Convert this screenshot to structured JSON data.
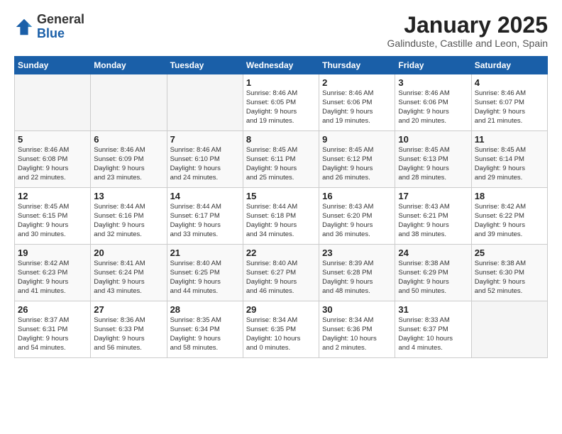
{
  "logo": {
    "general": "General",
    "blue": "Blue"
  },
  "title": "January 2025",
  "subtitle": "Galinduste, Castille and Leon, Spain",
  "weekdays": [
    "Sunday",
    "Monday",
    "Tuesday",
    "Wednesday",
    "Thursday",
    "Friday",
    "Saturday"
  ],
  "weeks": [
    [
      {
        "day": "",
        "info": ""
      },
      {
        "day": "",
        "info": ""
      },
      {
        "day": "",
        "info": ""
      },
      {
        "day": "1",
        "info": "Sunrise: 8:46 AM\nSunset: 6:05 PM\nDaylight: 9 hours\nand 19 minutes."
      },
      {
        "day": "2",
        "info": "Sunrise: 8:46 AM\nSunset: 6:06 PM\nDaylight: 9 hours\nand 19 minutes."
      },
      {
        "day": "3",
        "info": "Sunrise: 8:46 AM\nSunset: 6:06 PM\nDaylight: 9 hours\nand 20 minutes."
      },
      {
        "day": "4",
        "info": "Sunrise: 8:46 AM\nSunset: 6:07 PM\nDaylight: 9 hours\nand 21 minutes."
      }
    ],
    [
      {
        "day": "5",
        "info": "Sunrise: 8:46 AM\nSunset: 6:08 PM\nDaylight: 9 hours\nand 22 minutes."
      },
      {
        "day": "6",
        "info": "Sunrise: 8:46 AM\nSunset: 6:09 PM\nDaylight: 9 hours\nand 23 minutes."
      },
      {
        "day": "7",
        "info": "Sunrise: 8:46 AM\nSunset: 6:10 PM\nDaylight: 9 hours\nand 24 minutes."
      },
      {
        "day": "8",
        "info": "Sunrise: 8:45 AM\nSunset: 6:11 PM\nDaylight: 9 hours\nand 25 minutes."
      },
      {
        "day": "9",
        "info": "Sunrise: 8:45 AM\nSunset: 6:12 PM\nDaylight: 9 hours\nand 26 minutes."
      },
      {
        "day": "10",
        "info": "Sunrise: 8:45 AM\nSunset: 6:13 PM\nDaylight: 9 hours\nand 28 minutes."
      },
      {
        "day": "11",
        "info": "Sunrise: 8:45 AM\nSunset: 6:14 PM\nDaylight: 9 hours\nand 29 minutes."
      }
    ],
    [
      {
        "day": "12",
        "info": "Sunrise: 8:45 AM\nSunset: 6:15 PM\nDaylight: 9 hours\nand 30 minutes."
      },
      {
        "day": "13",
        "info": "Sunrise: 8:44 AM\nSunset: 6:16 PM\nDaylight: 9 hours\nand 32 minutes."
      },
      {
        "day": "14",
        "info": "Sunrise: 8:44 AM\nSunset: 6:17 PM\nDaylight: 9 hours\nand 33 minutes."
      },
      {
        "day": "15",
        "info": "Sunrise: 8:44 AM\nSunset: 6:18 PM\nDaylight: 9 hours\nand 34 minutes."
      },
      {
        "day": "16",
        "info": "Sunrise: 8:43 AM\nSunset: 6:20 PM\nDaylight: 9 hours\nand 36 minutes."
      },
      {
        "day": "17",
        "info": "Sunrise: 8:43 AM\nSunset: 6:21 PM\nDaylight: 9 hours\nand 38 minutes."
      },
      {
        "day": "18",
        "info": "Sunrise: 8:42 AM\nSunset: 6:22 PM\nDaylight: 9 hours\nand 39 minutes."
      }
    ],
    [
      {
        "day": "19",
        "info": "Sunrise: 8:42 AM\nSunset: 6:23 PM\nDaylight: 9 hours\nand 41 minutes."
      },
      {
        "day": "20",
        "info": "Sunrise: 8:41 AM\nSunset: 6:24 PM\nDaylight: 9 hours\nand 43 minutes."
      },
      {
        "day": "21",
        "info": "Sunrise: 8:40 AM\nSunset: 6:25 PM\nDaylight: 9 hours\nand 44 minutes."
      },
      {
        "day": "22",
        "info": "Sunrise: 8:40 AM\nSunset: 6:27 PM\nDaylight: 9 hours\nand 46 minutes."
      },
      {
        "day": "23",
        "info": "Sunrise: 8:39 AM\nSunset: 6:28 PM\nDaylight: 9 hours\nand 48 minutes."
      },
      {
        "day": "24",
        "info": "Sunrise: 8:38 AM\nSunset: 6:29 PM\nDaylight: 9 hours\nand 50 minutes."
      },
      {
        "day": "25",
        "info": "Sunrise: 8:38 AM\nSunset: 6:30 PM\nDaylight: 9 hours\nand 52 minutes."
      }
    ],
    [
      {
        "day": "26",
        "info": "Sunrise: 8:37 AM\nSunset: 6:31 PM\nDaylight: 9 hours\nand 54 minutes."
      },
      {
        "day": "27",
        "info": "Sunrise: 8:36 AM\nSunset: 6:33 PM\nDaylight: 9 hours\nand 56 minutes."
      },
      {
        "day": "28",
        "info": "Sunrise: 8:35 AM\nSunset: 6:34 PM\nDaylight: 9 hours\nand 58 minutes."
      },
      {
        "day": "29",
        "info": "Sunrise: 8:34 AM\nSunset: 6:35 PM\nDaylight: 10 hours\nand 0 minutes."
      },
      {
        "day": "30",
        "info": "Sunrise: 8:34 AM\nSunset: 6:36 PM\nDaylight: 10 hours\nand 2 minutes."
      },
      {
        "day": "31",
        "info": "Sunrise: 8:33 AM\nSunset: 6:37 PM\nDaylight: 10 hours\nand 4 minutes."
      },
      {
        "day": "",
        "info": ""
      }
    ]
  ]
}
